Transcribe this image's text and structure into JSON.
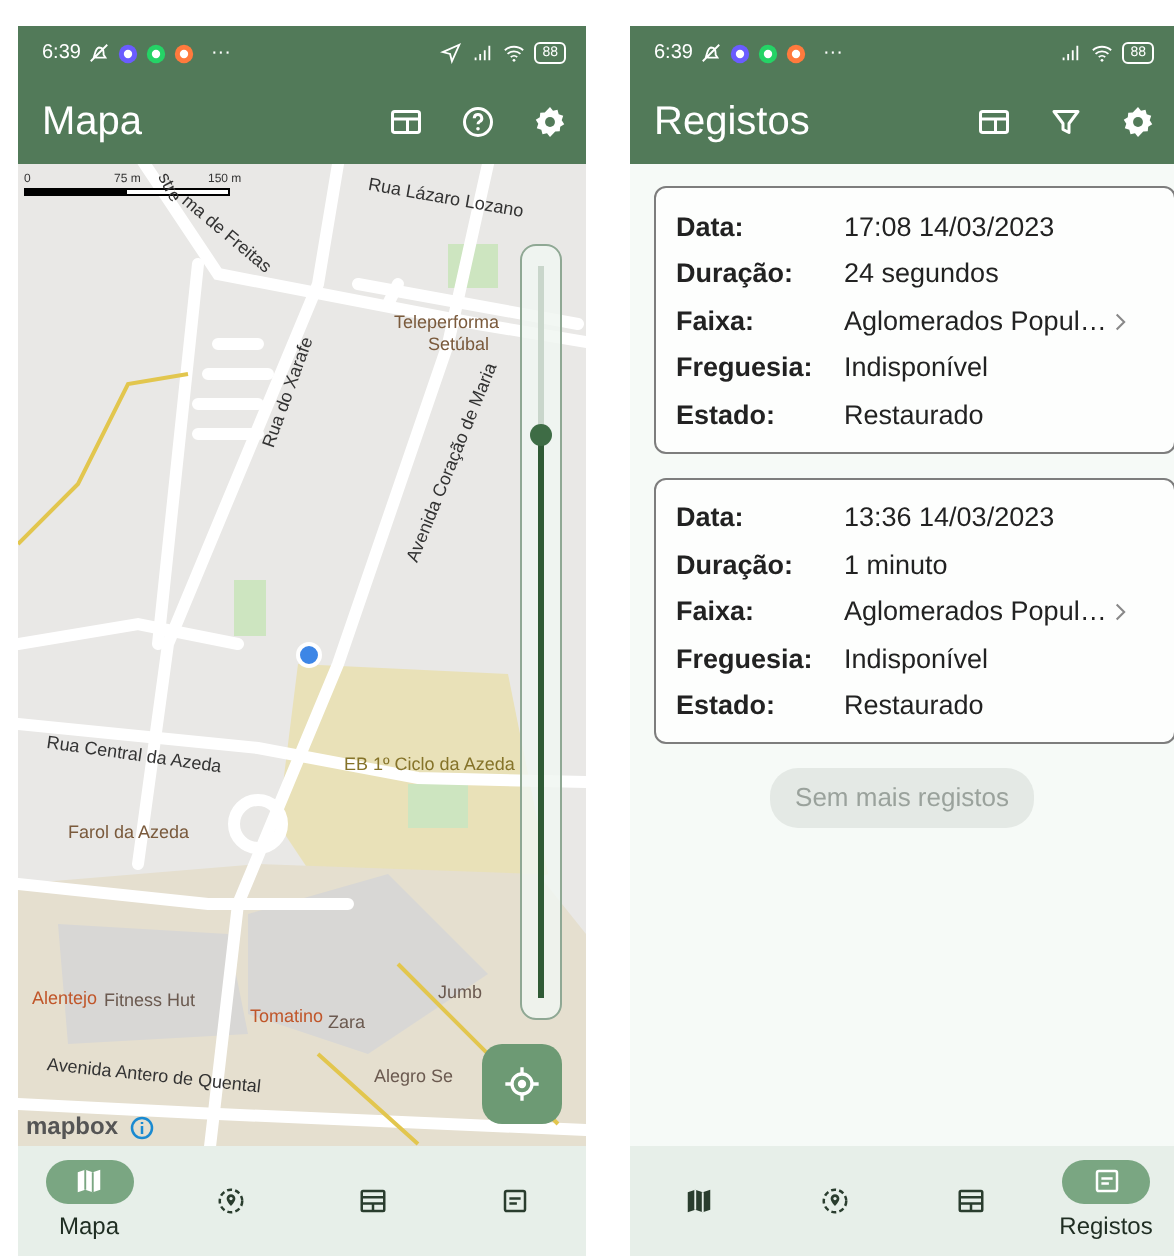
{
  "screens": [
    {
      "status_bar": {
        "time": "6:39",
        "more": "···",
        "battery": "88",
        "location": true
      },
      "app_bar": {
        "title": "Mapa",
        "actions": [
          {
            "kind": "panel"
          },
          {
            "kind": "help"
          },
          {
            "kind": "settings"
          }
        ]
      },
      "content": {
        "kind": "map",
        "scale": [
          "0",
          "75 m",
          "150 m"
        ],
        "labels": [
          {
            "text": "Rua Lázaro Lozano",
            "kind": "street"
          },
          {
            "text": "stre",
            "kind": "street"
          },
          {
            "text": "ma de Freitas",
            "kind": "street"
          },
          {
            "text": "Teleperforma",
            "kind": "poi"
          },
          {
            "text": "Setúbal",
            "kind": "poi"
          },
          {
            "text": "Rua do Xarafe",
            "kind": "street"
          },
          {
            "text": "Avenida Coração de Maria",
            "kind": "street"
          },
          {
            "text": "EB 1º Ciclo da Azeda",
            "kind": "school"
          },
          {
            "text": "Rua Central da Azeda",
            "kind": "street"
          },
          {
            "text": "Farol da Azeda",
            "kind": "poi"
          },
          {
            "text": "Alentejo",
            "kind": "food"
          },
          {
            "text": "Fitness Hut",
            "kind": "shop"
          },
          {
            "text": "Tomatino",
            "kind": "food"
          },
          {
            "text": "Zara",
            "kind": "shop"
          },
          {
            "text": "Jumb",
            "kind": "shop"
          },
          {
            "text": "Alegro Se",
            "kind": "shop"
          },
          {
            "text": "Avenida Antero de Quental",
            "kind": "street"
          }
        ],
        "attribution": "mapbox",
        "zoom_slider": {
          "level": 0.77
        }
      },
      "nav": [
        {
          "kind": "map",
          "label": "Mapa",
          "selected": true
        },
        {
          "kind": "location",
          "selected": false
        },
        {
          "kind": "table",
          "selected": false
        },
        {
          "kind": "record",
          "selected": false
        }
      ]
    },
    {
      "status_bar": {
        "time": "6:39",
        "more": "···",
        "battery": "88",
        "location": false
      },
      "app_bar": {
        "title": "Registos",
        "actions": [
          {
            "kind": "panel"
          },
          {
            "kind": "filter"
          },
          {
            "kind": "settings"
          }
        ]
      },
      "content": {
        "kind": "list",
        "records": [
          {
            "rows": [
              {
                "label": "Data:",
                "value": "17:08 14/03/2023"
              },
              {
                "label": "Duração:",
                "value": "24 segundos"
              },
              {
                "label": "Faixa:",
                "value": "Aglomerados Popul…",
                "chevron": true
              },
              {
                "label": "Freguesia:",
                "value": "Indisponível"
              },
              {
                "label": "Estado:",
                "value": "Restaurado"
              }
            ]
          },
          {
            "rows": [
              {
                "label": "Data:",
                "value": "13:36 14/03/2023"
              },
              {
                "label": "Duração:",
                "value": "1 minuto"
              },
              {
                "label": "Faixa:",
                "value": "Aglomerados Popul…",
                "chevron": true
              },
              {
                "label": "Freguesia:",
                "value": "Indisponível"
              },
              {
                "label": "Estado:",
                "value": "Restaurado"
              }
            ]
          }
        ],
        "more_button": {
          "label": "Sem mais registos",
          "disabled": true
        }
      },
      "nav": [
        {
          "kind": "map",
          "selected": false
        },
        {
          "kind": "location",
          "selected": false
        },
        {
          "kind": "table",
          "selected": false
        },
        {
          "kind": "record",
          "label": "Registos",
          "selected": true
        }
      ]
    }
  ]
}
